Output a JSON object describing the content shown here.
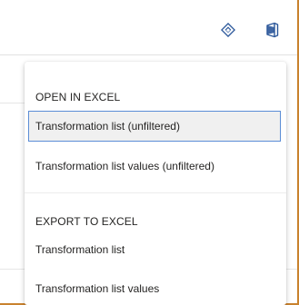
{
  "toolbar": {
    "icons": [
      "sync-icon",
      "office-icon"
    ]
  },
  "menu": {
    "open_section": {
      "header": "OPEN IN EXCEL",
      "items": [
        {
          "label": "Transformation list (unfiltered)",
          "selected": true
        },
        {
          "label": "Transformation list values (unfiltered)",
          "selected": false
        }
      ]
    },
    "export_section": {
      "header": "EXPORT TO EXCEL",
      "items": [
        {
          "label": "Transformation list",
          "selected": false
        },
        {
          "label": "Transformation list values",
          "selected": false
        }
      ]
    }
  },
  "colors": {
    "accent_border": "#c9822e",
    "selection_border": "#5b8dd6",
    "selection_fill": "#f0f0f0",
    "icon_color": "#2b579a",
    "text": "#252423"
  }
}
